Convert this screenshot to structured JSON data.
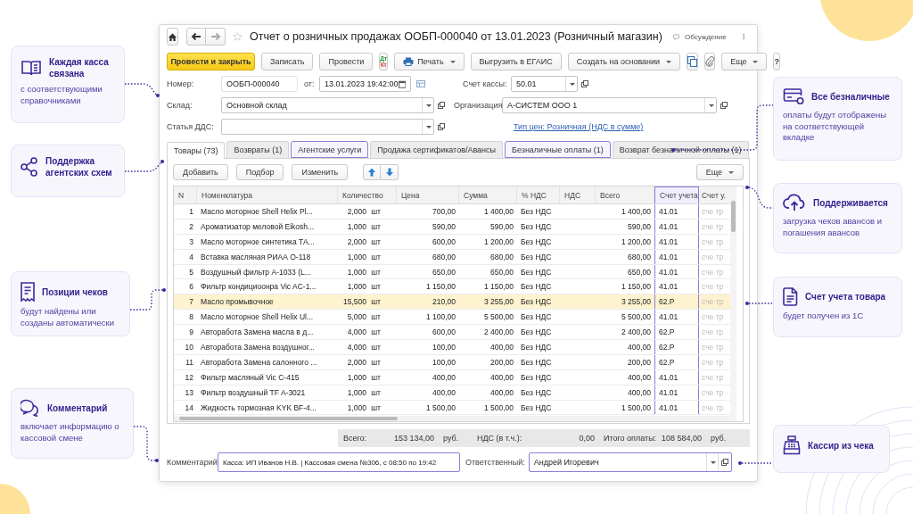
{
  "window": {
    "title": "Отчет о розничных продажах ООБП-000040 от 13.01.2023 (Розничный магазин)",
    "discussion": "Обсуждение"
  },
  "toolbar": [
    {
      "kind": "primary",
      "label": "Провести и закрыть"
    },
    {
      "kind": "button",
      "label": "Записать"
    },
    {
      "kind": "button",
      "label": "Провести"
    },
    {
      "kind": "dtkt",
      "label": "Дт",
      "label_2": "Кт"
    },
    {
      "kind": "print",
      "label": "Печать"
    },
    {
      "kind": "button",
      "label": "Выгрузить в ЕГАИС"
    },
    {
      "kind": "dropdown",
      "label": "Создать на основании"
    },
    {
      "kind": "copy"
    },
    {
      "kind": "clip"
    },
    {
      "kind": "dropdown",
      "label": "Еще"
    },
    {
      "kind": "button",
      "label": "?"
    }
  ],
  "form": {
    "number_label": "Номер:",
    "number": "ООБП-000040",
    "date_label": "от:",
    "date": "13.01.2023 19:42:00",
    "account_label": "Счет кассы:",
    "account": "50.01",
    "warehouse_label": "Склад:",
    "warehouse": "Основной склад",
    "org_label": "Организация:",
    "org": "А-СИСТЕМ ООО 1",
    "dds_label": "Статья ДДС:",
    "price_link": "Тип цен: Розничная (НДС в сумме)"
  },
  "tabs": [
    {
      "label": "Товары (73)",
      "selected": true,
      "highlighted": false
    },
    {
      "label": "Возвраты (1)",
      "selected": false,
      "highlighted": false
    },
    {
      "label": "Агентские услуги",
      "selected": false,
      "highlighted": true
    },
    {
      "label": "Продажа сертификатов/Авансы",
      "selected": false,
      "highlighted": false
    },
    {
      "label": "Безналичные оплаты (1)",
      "selected": false,
      "highlighted": true
    },
    {
      "label": "Возврат безналичной оплаты (1)",
      "selected": false,
      "highlighted": false
    }
  ],
  "table_toolbar": {
    "buttons": [
      "Добавить",
      "Подбор",
      "Изменить"
    ],
    "more": "Еще"
  },
  "table": {
    "columns": [
      {
        "label": "N",
        "highlighted": false
      },
      {
        "label": "Номенклатура",
        "highlighted": false
      },
      {
        "label": "Количество",
        "highlighted": false
      },
      {
        "label": "Цена",
        "highlighted": false
      },
      {
        "label": "Сумма",
        "highlighted": false
      },
      {
        "label": "% НДС",
        "highlighted": false
      },
      {
        "label": "НДС",
        "highlighted": false
      },
      {
        "label": "Всего",
        "highlighted": false
      },
      {
        "label": "Счет учета",
        "highlighted": true
      },
      {
        "label": "Счет у.",
        "highlighted": false
      }
    ],
    "rows": [
      {
        "n": "1",
        "name": "Масло моторное Shell Helix Pl...",
        "qty": "2,000",
        "unit": "шт",
        "price": "700,00",
        "sum": "1 400,00",
        "vat_rate": "Без НДС",
        "total": "1 400,00",
        "account": "41.01",
        "account_2": "сче тр",
        "selected": false
      },
      {
        "n": "2",
        "name": "Ароматизатор меловой Eikosh...",
        "qty": "1,000",
        "unit": "шт",
        "price": "590,00",
        "sum": "590,00",
        "vat_rate": "Без НДС",
        "total": "590,00",
        "account": "41.01",
        "account_2": "сче тр",
        "selected": false
      },
      {
        "n": "3",
        "name": "Масло моторное синтетика ТА...",
        "qty": "2,000",
        "unit": "шт",
        "price": "600,00",
        "sum": "1 200,00",
        "vat_rate": "Без НДС",
        "total": "1 200,00",
        "account": "41.01",
        "account_2": "сче тр",
        "selected": false
      },
      {
        "n": "4",
        "name": "Вставка масляная РИАА О-118",
        "qty": "1,000",
        "unit": "шт",
        "price": "680,00",
        "sum": "680,00",
        "vat_rate": "Без НДС",
        "total": "680,00",
        "account": "41.01",
        "account_2": "сче тр",
        "selected": false
      },
      {
        "n": "5",
        "name": "Воздушный фильтр А-1033 (L...",
        "qty": "1,000",
        "unit": "шт",
        "price": "650,00",
        "sum": "650,00",
        "vat_rate": "Без НДС",
        "total": "650,00",
        "account": "41.01",
        "account_2": "сче тр",
        "selected": false
      },
      {
        "n": "6",
        "name": "Фильтр кондициоонра Vic AC-1...",
        "qty": "1,000",
        "unit": "шт",
        "price": "1 150,00",
        "sum": "1 150,00",
        "vat_rate": "Без НДС",
        "total": "1 150,00",
        "account": "41.01",
        "account_2": "сче тр",
        "selected": false
      },
      {
        "n": "7",
        "name": "Масло промывочное",
        "qty": "15,500",
        "unit": "шт",
        "price": "210,00",
        "sum": "3 255,00",
        "vat_rate": "Без НДС",
        "total": "3 255,00",
        "account": "62.Р",
        "account_2": "сче тр",
        "selected": true
      },
      {
        "n": "8",
        "name": "Масло моторное Shell Helix Ul...",
        "qty": "5,000",
        "unit": "шт",
        "price": "1 100,00",
        "sum": "5 500,00",
        "vat_rate": "Без НДС",
        "total": "5 500,00",
        "account": "41.01",
        "account_2": "сче тр",
        "selected": false
      },
      {
        "n": "9",
        "name": "Авторабота Замена масла в д...",
        "qty": "4,000",
        "unit": "шт",
        "price": "600,00",
        "sum": "2 400,00",
        "vat_rate": "Без НДС",
        "total": "2 400,00",
        "account": "62.Р",
        "account_2": "сче тр",
        "selected": false
      },
      {
        "n": "10",
        "name": "Авторабота Замена воздушног...",
        "qty": "4,000",
        "unit": "шт",
        "price": "100,00",
        "sum": "400,00",
        "vat_rate": "Без НДС",
        "total": "400,00",
        "account": "62.Р",
        "account_2": "сче тр",
        "selected": false
      },
      {
        "n": "11",
        "name": "Авторабота Замена салонного ...",
        "qty": "2,000",
        "unit": "шт",
        "price": "100,00",
        "sum": "200,00",
        "vat_rate": "Без НДС",
        "total": "200,00",
        "account": "62.Р",
        "account_2": "сче тр",
        "selected": false
      },
      {
        "n": "12",
        "name": "Фильтр масляный Vic C-415",
        "qty": "1,000",
        "unit": "шт",
        "price": "400,00",
        "sum": "400,00",
        "vat_rate": "Без НДС",
        "total": "400,00",
        "account": "41.01",
        "account_2": "сче тр",
        "selected": false
      },
      {
        "n": "13",
        "name": "Фильтр воздушный TF A-3021",
        "qty": "1,000",
        "unit": "шт",
        "price": "400,00",
        "sum": "400,00",
        "vat_rate": "Без НДС",
        "total": "400,00",
        "account": "41.01",
        "account_2": "сче тр",
        "selected": false
      },
      {
        "n": "14",
        "name": "Жидкость тормозная KYK BF-4...",
        "qty": "1,000",
        "unit": "шт",
        "price": "1 500,00",
        "sum": "1 500,00",
        "vat_rate": "Без НДС",
        "total": "1 500,00",
        "account": "41.01",
        "account_2": "сче тр",
        "selected": false
      }
    ]
  },
  "totals": {
    "total_label": "Всего:",
    "total": "153 134,00",
    "currency": "руб.",
    "vat_label": "НДС (в т.ч.):",
    "vat": "0,00",
    "paid_label": "Итого оплаты:",
    "paid": "108 584,00",
    "currency_2": "руб."
  },
  "footer": {
    "comment_label": "Комментарий:",
    "comment": "Касса: ИП Иванов Н.В. | Кассовая смена №306, с 08:50 по 19:42",
    "comment_highlighted": true,
    "responsible_label": "Ответственный:",
    "responsible": "Андрей Игоревич",
    "responsible_highlighted": true
  },
  "callouts": [
    {
      "title": "Каждая касса связана",
      "text": "с соответствующими справочниками"
    },
    {
      "title": "Поддержка агентских схем"
    },
    {
      "title": "Позиции чеков",
      "text": "будут найдены или созданы автоматически"
    },
    {
      "title": "Комментарий",
      "text": "включает информацию о кассовой смене"
    },
    {
      "title": "Все безналичные",
      "text": "оплаты будут отображены на соответствующей вкладке"
    },
    {
      "title": "Поддерживается",
      "text": "загрузка чеков авансов и погашения авансов"
    },
    {
      "title": "Счет учета товара",
      "text": "будет получен из 1С"
    },
    {
      "title": "Кассир из чека"
    }
  ]
}
